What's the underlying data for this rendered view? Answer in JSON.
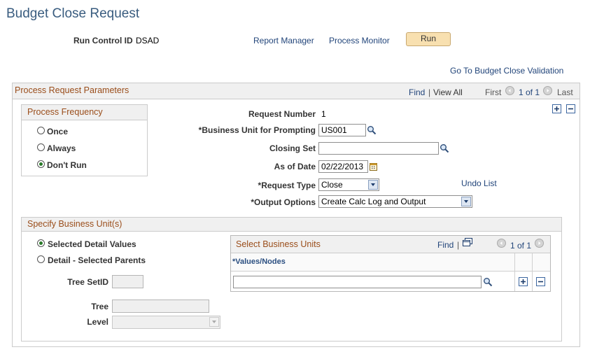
{
  "page": {
    "title": "Budget Close Request",
    "run_control_label": "Run Control ID",
    "run_control_value": "DSAD",
    "report_manager": "Report Manager",
    "process_monitor": "Process Monitor",
    "run_button": "Run",
    "go_to_validation": "Go To Budget Close Validation"
  },
  "process_params": {
    "header": "Process Request Parameters",
    "find": "Find",
    "separator": "|",
    "view_all": "View All",
    "first": "First",
    "count": "1 of 1",
    "last": "Last"
  },
  "frequency": {
    "header": "Process Frequency",
    "options": [
      "Once",
      "Always",
      "Don't Run"
    ],
    "selected": "Don't Run"
  },
  "fields": {
    "request_number_label": "Request Number",
    "request_number_value": "1",
    "business_unit_label": "*Business Unit for Prompting",
    "business_unit_value": "US001",
    "closing_set_label": "Closing Set",
    "closing_set_value": "",
    "as_of_date_label": "As of Date",
    "as_of_date_value": "02/22/2013",
    "request_type_label": "*Request Type",
    "request_type_value": "Close",
    "undo_list": "Undo List",
    "output_options_label": "*Output Options",
    "output_options_value": "Create Calc Log and Output"
  },
  "specify_bu": {
    "header": "Specify Business Unit(s)",
    "radio_selected_detail": "Selected Detail Values",
    "radio_detail_parents": "Detail - Selected Parents",
    "selected": "Selected Detail Values",
    "tree_setid_label": "Tree SetID",
    "tree_label": "Tree",
    "level_label": "Level"
  },
  "select_bu_grid": {
    "header": "Select Business Units",
    "find": "Find",
    "separator": "|",
    "count": "1 of 1",
    "column": "*Values/Nodes",
    "row_value": ""
  },
  "colors": {
    "title": "#395c7f",
    "section_header_text": "#9a4d1a",
    "link": "#22457a",
    "run_button_bg": "#f8e0b0"
  }
}
